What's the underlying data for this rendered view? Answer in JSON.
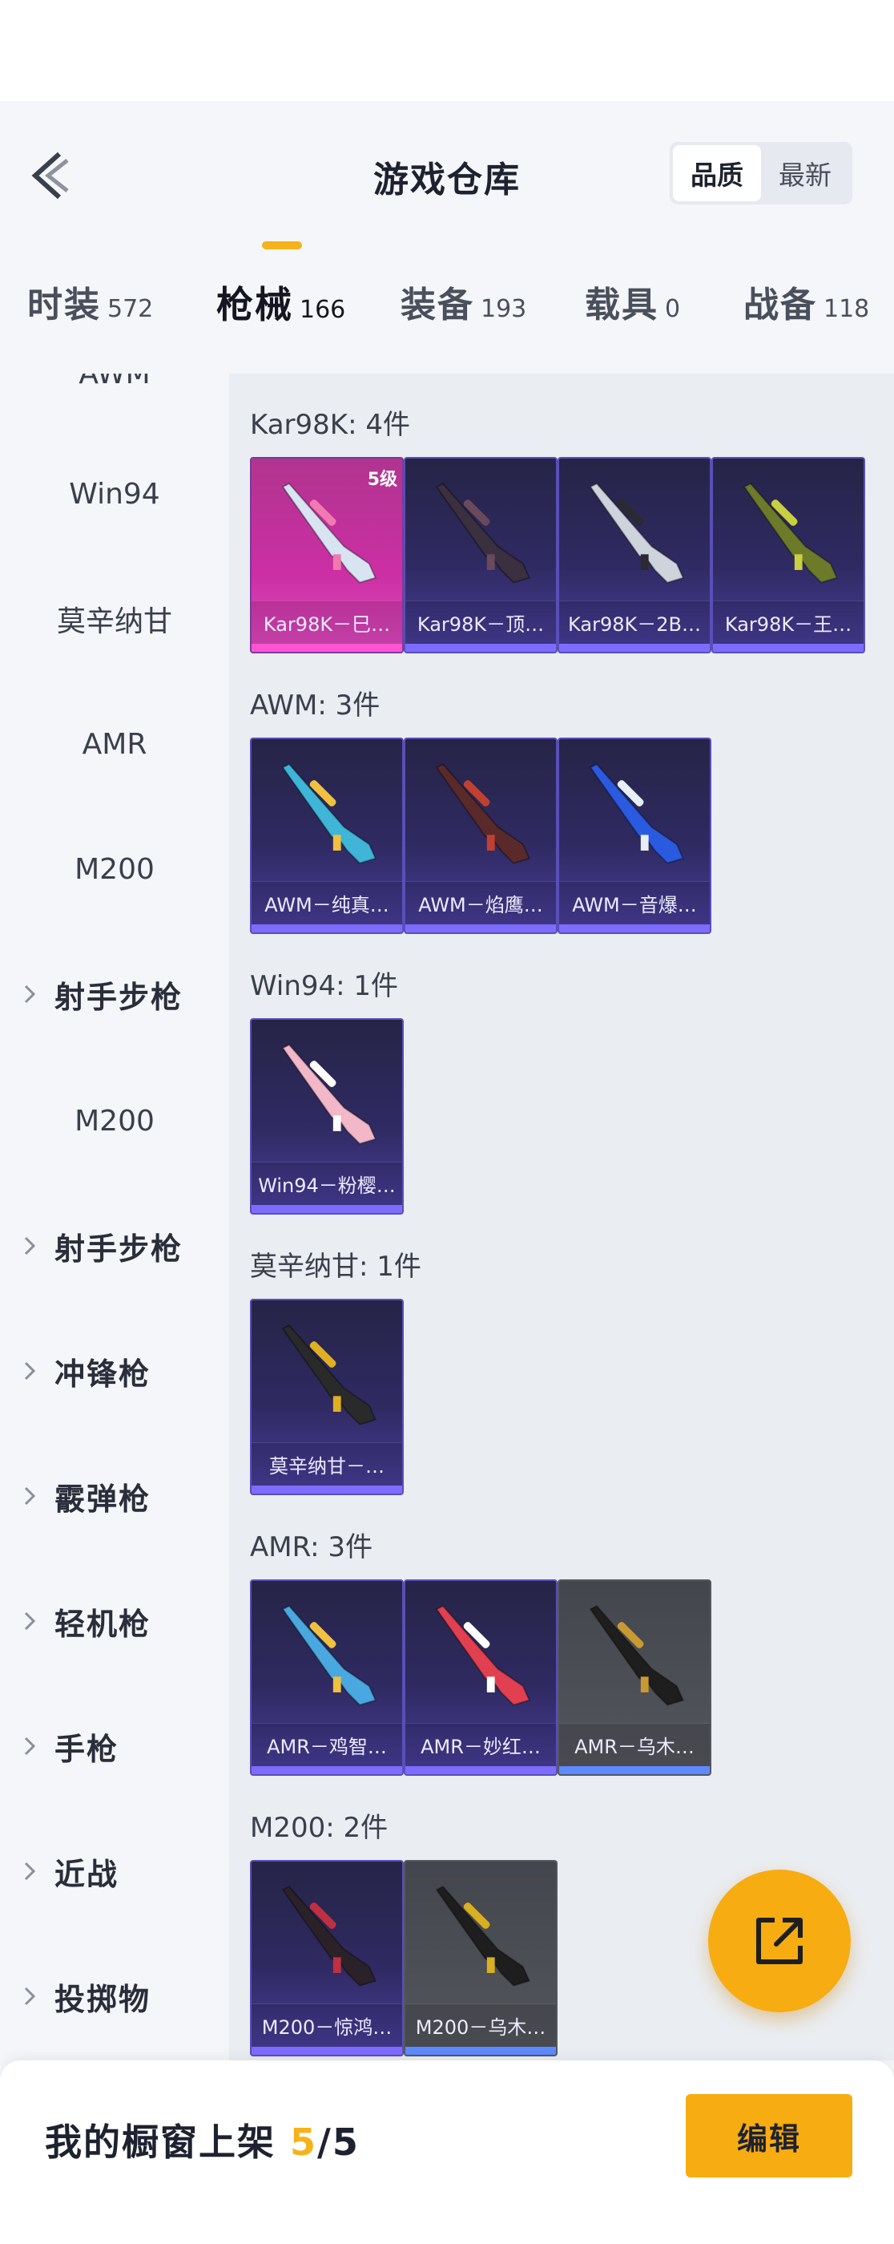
{
  "header": {
    "title": "游戏仓库",
    "sort_options": [
      {
        "label": "品质",
        "active": true
      },
      {
        "label": "最新",
        "active": false
      }
    ]
  },
  "tabs": [
    {
      "label": "时装",
      "count": "572",
      "active": false
    },
    {
      "label": "枪械",
      "count": "166",
      "active": true
    },
    {
      "label": "装备",
      "count": "193",
      "active": false
    },
    {
      "label": "载具",
      "count": "0",
      "active": false
    },
    {
      "label": "战备",
      "count": "118",
      "active": false
    }
  ],
  "sidebar": {
    "items": [
      {
        "label": "AWM",
        "type": "sub"
      },
      {
        "label": "Win94",
        "type": "sub"
      },
      {
        "label": "莫辛纳甘",
        "type": "sub"
      },
      {
        "label": "AMR",
        "type": "sub"
      },
      {
        "label": "M200",
        "type": "sub"
      },
      {
        "label": "射手步枪",
        "type": "category"
      },
      {
        "label": "M200",
        "type": "sub"
      },
      {
        "label": "射手步枪",
        "type": "category"
      },
      {
        "label": "冲锋枪",
        "type": "category"
      },
      {
        "label": "霰弹枪",
        "type": "category"
      },
      {
        "label": "轻机枪",
        "type": "category"
      },
      {
        "label": "手枪",
        "type": "category"
      },
      {
        "label": "近战",
        "type": "category"
      },
      {
        "label": "投掷物",
        "type": "category"
      }
    ]
  },
  "groups": [
    {
      "title": "Kar98K: 4件",
      "items": [
        {
          "name": "Kar98K－巳…",
          "style": "gold",
          "badge": "5级",
          "gun_color": "#d9e4f2",
          "accent": "#f07ab0"
        },
        {
          "name": "Kar98K－顶…",
          "style": "purple",
          "badge": "",
          "gun_color": "#3a3040",
          "accent": "#6a4a5a"
        },
        {
          "name": "Kar98K－2B…",
          "style": "purple",
          "badge": "",
          "gun_color": "#cfd3dc",
          "accent": "#2a2a30"
        },
        {
          "name": "Kar98K－王…",
          "style": "purple",
          "badge": "",
          "gun_color": "#6c7a2a",
          "accent": "#c8d040"
        }
      ]
    },
    {
      "title": "AWM: 3件",
      "items": [
        {
          "name": "AWM－纯真…",
          "style": "purple",
          "badge": "",
          "gun_color": "#3fb6d8",
          "accent": "#f0c040"
        },
        {
          "name": "AWM－焰鹰…",
          "style": "purple",
          "badge": "",
          "gun_color": "#5a2a2a",
          "accent": "#c04030"
        },
        {
          "name": "AWM－音爆…",
          "style": "purple",
          "badge": "",
          "gun_color": "#2a5ae0",
          "accent": "#e8eef8"
        }
      ]
    },
    {
      "title": "Win94: 1件",
      "items": [
        {
          "name": "Win94－粉樱…",
          "style": "purple",
          "badge": "",
          "gun_color": "#f2b8c8",
          "accent": "#ffffff"
        }
      ]
    },
    {
      "title": "莫辛纳甘: 1件",
      "items": [
        {
          "name": "莫辛纳甘－…",
          "style": "purple",
          "badge": "",
          "gun_color": "#2a2a2a",
          "accent": "#e0b020"
        }
      ]
    },
    {
      "title": "AMR: 3件",
      "items": [
        {
          "name": "AMR－鸡智…",
          "style": "purple",
          "badge": "",
          "gun_color": "#4aa8e0",
          "accent": "#f0c040"
        },
        {
          "name": "AMR－妙红…",
          "style": "purple",
          "badge": "",
          "gun_color": "#e04050",
          "accent": "#ffffff"
        },
        {
          "name": "AMR－乌木…",
          "style": "gray",
          "badge": "",
          "gun_color": "#1e1e1e",
          "accent": "#c89a30"
        }
      ]
    },
    {
      "title": "M200: 2件",
      "items": [
        {
          "name": "M200－惊鸿…",
          "style": "purple",
          "badge": "",
          "gun_color": "#2a2228",
          "accent": "#c03040"
        },
        {
          "name": "M200－乌木…",
          "style": "gray",
          "badge": "",
          "gun_color": "#1e1e1e",
          "accent": "#d8b020"
        }
      ]
    }
  ],
  "bottom": {
    "label": "我的橱窗上架",
    "current": "5",
    "total": "/5",
    "edit_label": "编辑"
  }
}
